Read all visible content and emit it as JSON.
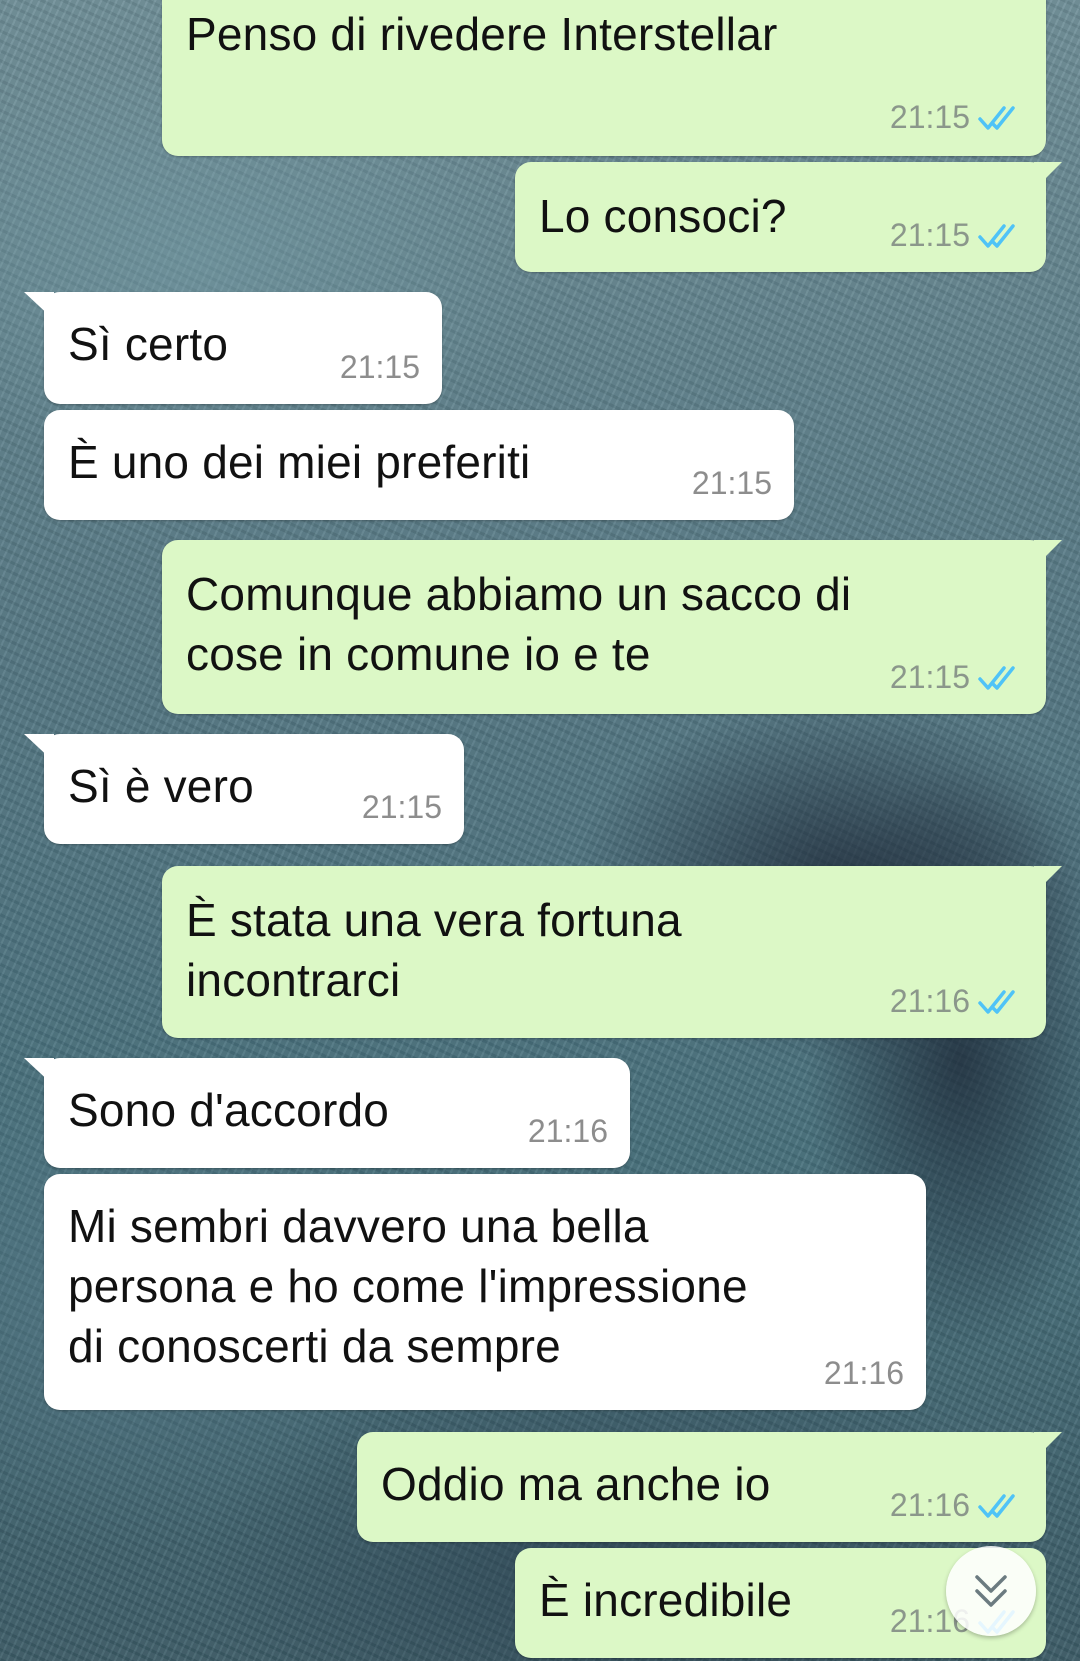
{
  "messages": [
    {
      "dir": "out",
      "text": "Penso di rivedere Interstellar",
      "time": "21:15",
      "read": true
    },
    {
      "dir": "out",
      "text": "Lo consoci?",
      "time": "21:15",
      "read": true
    },
    {
      "dir": "in",
      "text": "Sì certo",
      "time": "21:15"
    },
    {
      "dir": "in",
      "text": "È uno dei miei preferiti",
      "time": "21:15"
    },
    {
      "dir": "out",
      "text": "Comunque abbiamo un sacco di\ncose in comune io e te",
      "time": "21:15",
      "read": true
    },
    {
      "dir": "in",
      "text": "Sì è vero",
      "time": "21:15"
    },
    {
      "dir": "out",
      "text": "È stata una vera fortuna\nincontrarci",
      "time": "21:16",
      "read": true
    },
    {
      "dir": "in",
      "text": "Sono d'accordo",
      "time": "21:16"
    },
    {
      "dir": "in",
      "text": "Mi sembri davvero una bella\npersona e ho come l'impressione\ndi conoscerti da sempre",
      "time": "21:16"
    },
    {
      "dir": "out",
      "text": "Oddio ma anche io",
      "time": "21:16",
      "read": true
    },
    {
      "dir": "out",
      "text": "È incredibile",
      "time": "21:16",
      "read": true
    }
  ],
  "colors": {
    "outgoing_bubble": "#dcf8c6",
    "incoming_bubble": "#ffffff",
    "read_ticks": "#4fc3f7",
    "timestamp": "#8b978b"
  },
  "icons": {
    "read_receipt": "double-check-icon",
    "scroll_down": "double-chevron-down-icon"
  }
}
